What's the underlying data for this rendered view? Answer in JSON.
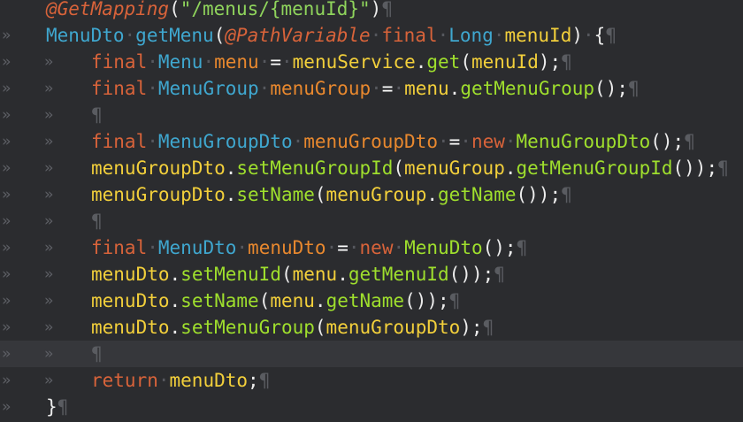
{
  "editor": {
    "indent_marker": "»",
    "lines": [
      {
        "indent": 0,
        "current": false,
        "tokens": [
          {
            "t": "@GetMapping",
            "c": "ann"
          },
          {
            "t": "(",
            "c": "punc"
          },
          {
            "t": "\"/menus/{menuId}\"",
            "c": "str"
          },
          {
            "t": ")",
            "c": "punc"
          },
          {
            "t": "¶",
            "c": "pilcrow"
          }
        ]
      },
      {
        "indent": 1,
        "current": false,
        "tokens": [
          {
            "t": "MenuDto",
            "c": "type"
          },
          {
            "t": "·",
            "c": "ws"
          },
          {
            "t": "getMenu",
            "c": "type"
          },
          {
            "t": "(",
            "c": "punc"
          },
          {
            "t": "@PathVariable",
            "c": "ann"
          },
          {
            "t": "·",
            "c": "ws"
          },
          {
            "t": "final",
            "c": "kw"
          },
          {
            "t": "·",
            "c": "ws"
          },
          {
            "t": "Long",
            "c": "type"
          },
          {
            "t": "·",
            "c": "ws"
          },
          {
            "t": "menuId",
            "c": "obj"
          },
          {
            "t": ")",
            "c": "punc"
          },
          {
            "t": "·",
            "c": "ws"
          },
          {
            "t": "{",
            "c": "punc"
          },
          {
            "t": "¶",
            "c": "pilcrow"
          }
        ]
      },
      {
        "indent": 2,
        "current": false,
        "tokens": [
          {
            "t": "final",
            "c": "kw"
          },
          {
            "t": "·",
            "c": "ws"
          },
          {
            "t": "Menu",
            "c": "type"
          },
          {
            "t": "·",
            "c": "ws"
          },
          {
            "t": "menu",
            "c": "var"
          },
          {
            "t": "·",
            "c": "ws"
          },
          {
            "t": "=",
            "c": "op"
          },
          {
            "t": "·",
            "c": "ws"
          },
          {
            "t": "menuService",
            "c": "obj"
          },
          {
            "t": ".",
            "c": "punc"
          },
          {
            "t": "get",
            "c": "method"
          },
          {
            "t": "(",
            "c": "punc"
          },
          {
            "t": "menuId",
            "c": "obj"
          },
          {
            "t": ");",
            "c": "punc"
          },
          {
            "t": "¶",
            "c": "pilcrow"
          }
        ]
      },
      {
        "indent": 2,
        "current": false,
        "tokens": [
          {
            "t": "final",
            "c": "kw"
          },
          {
            "t": "·",
            "c": "ws"
          },
          {
            "t": "MenuGroup",
            "c": "type"
          },
          {
            "t": "·",
            "c": "ws"
          },
          {
            "t": "menuGroup",
            "c": "var"
          },
          {
            "t": "·",
            "c": "ws"
          },
          {
            "t": "=",
            "c": "op"
          },
          {
            "t": "·",
            "c": "ws"
          },
          {
            "t": "menu",
            "c": "obj"
          },
          {
            "t": ".",
            "c": "punc"
          },
          {
            "t": "getMenuGroup",
            "c": "method"
          },
          {
            "t": "();",
            "c": "punc"
          },
          {
            "t": "¶",
            "c": "pilcrow"
          }
        ]
      },
      {
        "indent": 2,
        "current": false,
        "tokens": [
          {
            "t": "¶",
            "c": "pilcrow"
          }
        ]
      },
      {
        "indent": 2,
        "current": false,
        "tokens": [
          {
            "t": "final",
            "c": "kw"
          },
          {
            "t": "·",
            "c": "ws"
          },
          {
            "t": "MenuGroupDto",
            "c": "type"
          },
          {
            "t": "·",
            "c": "ws"
          },
          {
            "t": "menuGroupDto",
            "c": "var"
          },
          {
            "t": "·",
            "c": "ws"
          },
          {
            "t": "=",
            "c": "op"
          },
          {
            "t": "·",
            "c": "ws"
          },
          {
            "t": "new",
            "c": "kw"
          },
          {
            "t": "·",
            "c": "ws"
          },
          {
            "t": "MenuGroupDto",
            "c": "method"
          },
          {
            "t": "();",
            "c": "punc"
          },
          {
            "t": "¶",
            "c": "pilcrow"
          }
        ]
      },
      {
        "indent": 2,
        "current": false,
        "tokens": [
          {
            "t": "menuGroupDto",
            "c": "obj"
          },
          {
            "t": ".",
            "c": "punc"
          },
          {
            "t": "setMenuGroupId",
            "c": "method"
          },
          {
            "t": "(",
            "c": "punc"
          },
          {
            "t": "menuGroup",
            "c": "obj"
          },
          {
            "t": ".",
            "c": "punc"
          },
          {
            "t": "getMenuGroupId",
            "c": "method"
          },
          {
            "t": "());",
            "c": "punc"
          },
          {
            "t": "¶",
            "c": "pilcrow"
          }
        ]
      },
      {
        "indent": 2,
        "current": false,
        "tokens": [
          {
            "t": "menuGroupDto",
            "c": "obj"
          },
          {
            "t": ".",
            "c": "punc"
          },
          {
            "t": "setName",
            "c": "method"
          },
          {
            "t": "(",
            "c": "punc"
          },
          {
            "t": "menuGroup",
            "c": "obj"
          },
          {
            "t": ".",
            "c": "punc"
          },
          {
            "t": "getName",
            "c": "method"
          },
          {
            "t": "());",
            "c": "punc"
          },
          {
            "t": "¶",
            "c": "pilcrow"
          }
        ]
      },
      {
        "indent": 2,
        "current": false,
        "tokens": [
          {
            "t": "¶",
            "c": "pilcrow"
          }
        ]
      },
      {
        "indent": 2,
        "current": false,
        "tokens": [
          {
            "t": "final",
            "c": "kw"
          },
          {
            "t": "·",
            "c": "ws"
          },
          {
            "t": "MenuDto",
            "c": "type"
          },
          {
            "t": "·",
            "c": "ws"
          },
          {
            "t": "menuDto",
            "c": "var"
          },
          {
            "t": "·",
            "c": "ws"
          },
          {
            "t": "=",
            "c": "op"
          },
          {
            "t": "·",
            "c": "ws"
          },
          {
            "t": "new",
            "c": "kw"
          },
          {
            "t": "·",
            "c": "ws"
          },
          {
            "t": "MenuDto",
            "c": "method"
          },
          {
            "t": "();",
            "c": "punc"
          },
          {
            "t": "¶",
            "c": "pilcrow"
          }
        ]
      },
      {
        "indent": 2,
        "current": false,
        "tokens": [
          {
            "t": "menuDto",
            "c": "obj"
          },
          {
            "t": ".",
            "c": "punc"
          },
          {
            "t": "setMenuId",
            "c": "method"
          },
          {
            "t": "(",
            "c": "punc"
          },
          {
            "t": "menu",
            "c": "obj"
          },
          {
            "t": ".",
            "c": "punc"
          },
          {
            "t": "getMenuId",
            "c": "method"
          },
          {
            "t": "());",
            "c": "punc"
          },
          {
            "t": "¶",
            "c": "pilcrow"
          }
        ]
      },
      {
        "indent": 2,
        "current": false,
        "tokens": [
          {
            "t": "menuDto",
            "c": "obj"
          },
          {
            "t": ".",
            "c": "punc"
          },
          {
            "t": "setName",
            "c": "method"
          },
          {
            "t": "(",
            "c": "punc"
          },
          {
            "t": "menu",
            "c": "obj"
          },
          {
            "t": ".",
            "c": "punc"
          },
          {
            "t": "getName",
            "c": "method"
          },
          {
            "t": "());",
            "c": "punc"
          },
          {
            "t": "¶",
            "c": "pilcrow"
          }
        ]
      },
      {
        "indent": 2,
        "current": false,
        "tokens": [
          {
            "t": "menuDto",
            "c": "obj"
          },
          {
            "t": ".",
            "c": "punc"
          },
          {
            "t": "setMenuGroup",
            "c": "method"
          },
          {
            "t": "(",
            "c": "punc"
          },
          {
            "t": "menuGroupDto",
            "c": "obj"
          },
          {
            "t": ");",
            "c": "punc"
          },
          {
            "t": "¶",
            "c": "pilcrow"
          }
        ]
      },
      {
        "indent": 2,
        "current": true,
        "tokens": [
          {
            "t": "¶",
            "c": "pilcrow"
          }
        ]
      },
      {
        "indent": 2,
        "current": false,
        "tokens": [
          {
            "t": "return",
            "c": "kw"
          },
          {
            "t": "·",
            "c": "ws"
          },
          {
            "t": "menuDto",
            "c": "obj"
          },
          {
            "t": ";",
            "c": "punc"
          },
          {
            "t": "¶",
            "c": "pilcrow"
          }
        ]
      },
      {
        "indent": 1,
        "current": false,
        "tokens": [
          {
            "t": "}",
            "c": "punc"
          },
          {
            "t": "¶",
            "c": "pilcrow"
          }
        ]
      }
    ]
  }
}
